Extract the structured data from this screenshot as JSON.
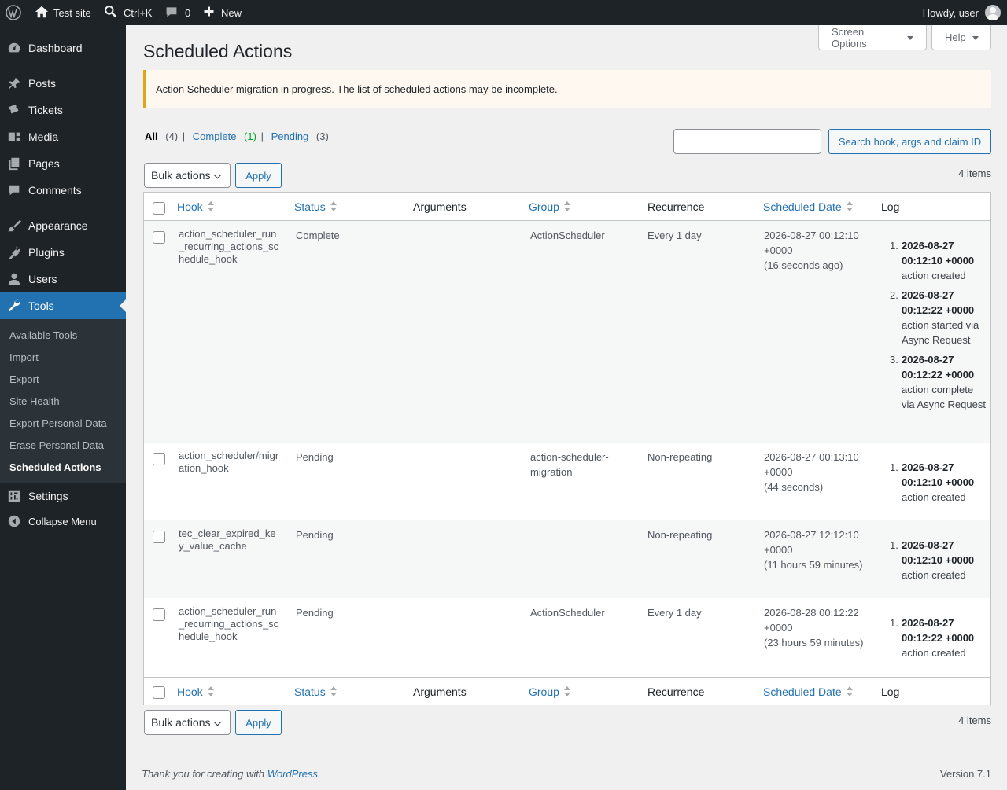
{
  "adminbar": {
    "site_name": "Test site",
    "search_shortcut": "Ctrl+K",
    "comments_count": "0",
    "new_label": "New",
    "howdy": "Howdy, user"
  },
  "sidebar": {
    "items": [
      {
        "label": "Dashboard",
        "icon": "dashboard-icon"
      },
      {
        "label": "Posts",
        "icon": "pin-icon"
      },
      {
        "label": "Tickets",
        "icon": "tickets-icon"
      },
      {
        "label": "Media",
        "icon": "media-icon"
      },
      {
        "label": "Pages",
        "icon": "pages-icon"
      },
      {
        "label": "Comments",
        "icon": "comments-icon"
      },
      {
        "label": "Appearance",
        "icon": "brush-icon"
      },
      {
        "label": "Plugins",
        "icon": "plugin-icon"
      },
      {
        "label": "Users",
        "icon": "users-icon"
      },
      {
        "label": "Tools",
        "icon": "wrench-icon"
      },
      {
        "label": "Settings",
        "icon": "settings-icon"
      },
      {
        "label": "Collapse Menu",
        "icon": "collapse-icon"
      }
    ],
    "tools_submenu": [
      "Available Tools",
      "Import",
      "Export",
      "Site Health",
      "Export Personal Data",
      "Erase Personal Data",
      "Scheduled Actions"
    ]
  },
  "screen_options": "Screen Options",
  "help": "Help",
  "page_title": "Scheduled Actions",
  "notice": "Action Scheduler migration in progress. The list of scheduled actions may be incomplete.",
  "filters": {
    "all": "All",
    "all_count": "(4)",
    "complete": "Complete",
    "complete_count": "(1)",
    "pending": "Pending",
    "pending_count": "(3)",
    "sep": "|"
  },
  "search": {
    "placeholder": "",
    "button": "Search hook, args and claim ID"
  },
  "bulk": {
    "label": "Bulk actions",
    "apply": "Apply",
    "items": "4 items"
  },
  "columns": {
    "hook": "Hook",
    "status": "Status",
    "arguments": "Arguments",
    "group": "Group",
    "recurrence": "Recurrence",
    "scheduled": "Scheduled Date",
    "log": "Log"
  },
  "rows": [
    {
      "hook": "action_scheduler_run_recurring_actions_schedule_hook",
      "status": "Complete",
      "group": "ActionScheduler",
      "recurrence": "Every 1 day",
      "date1": "2026-08-27 00:12:10",
      "date2": "+0000",
      "date3": "(16 seconds ago)",
      "log": [
        {
          "n": "1.",
          "ts": "2026-08-27 00:12:10 +0000",
          "msg": "action created"
        },
        {
          "n": "2.",
          "ts": "2026-08-27 00:12:22 +0000",
          "msg": "action started via Async Request"
        },
        {
          "n": "3.",
          "ts": "2026-08-27 00:12:22 +0000",
          "msg": "action complete via Async Request"
        }
      ]
    },
    {
      "hook": "action_scheduler/migration_hook",
      "status": "Pending",
      "group": "action-scheduler-migration",
      "recurrence": "Non-repeating",
      "date1": "2026-08-27 00:13:10",
      "date2": "+0000",
      "date3": "(44 seconds)",
      "log": [
        {
          "n": "1.",
          "ts": "2026-08-27 00:12:10 +0000",
          "msg": "action created"
        }
      ]
    },
    {
      "hook": "tec_clear_expired_key_value_cache",
      "status": "Pending",
      "group": "",
      "recurrence": "Non-repeating",
      "date1": "2026-08-27 12:12:10",
      "date2": "+0000",
      "date3": "(11 hours 59 minutes)",
      "log": [
        {
          "n": "1.",
          "ts": "2026-08-27 00:12:10 +0000",
          "msg": "action created"
        }
      ]
    },
    {
      "hook": "action_scheduler_run_recurring_actions_schedule_hook",
      "status": "Pending",
      "group": "ActionScheduler",
      "recurrence": "Every 1 day",
      "date1": "2026-08-28 00:12:22",
      "date2": "+0000",
      "date3": "(23 hours 59 minutes)",
      "log": [
        {
          "n": "1.",
          "ts": "2026-08-27 00:12:22 +0000",
          "msg": "action created"
        }
      ]
    }
  ],
  "footer": {
    "thanks_pre": "Thank you for creating with ",
    "wp_link": "WordPress",
    "thanks_post": ".",
    "version": "Version 7.1"
  }
}
